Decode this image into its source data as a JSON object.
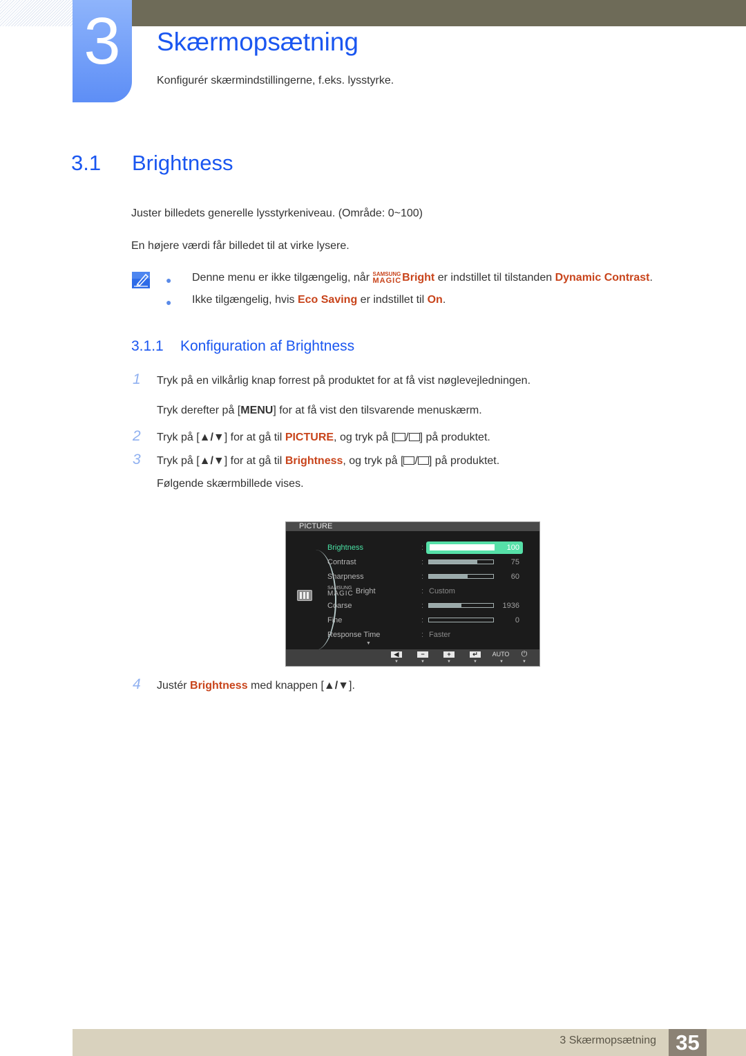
{
  "chapter": {
    "number": "3",
    "title": "Skærmopsætning",
    "subtitle": "Konfigurér skærmindstillingerne, f.eks. lysstyrke."
  },
  "section": {
    "number": "3.1",
    "title": "Brightness",
    "para1": "Juster billedets generelle lysstyrkeniveau. (Område: 0~100)",
    "para2": "En højere værdi får billedet til at virke lysere."
  },
  "notes": {
    "icon": "note-pencil-icon",
    "note1": {
      "before": "Denne menu er ikke tilgængelig, når ",
      "magic_top": "SAMSUNG",
      "magic_bottom": "MAGIC",
      "magic_word": "Bright",
      "middle": " er indstillet til tilstanden ",
      "highlight": "Dynamic Contrast",
      "after": "."
    },
    "note2": {
      "before": "Ikke tilgængelig, hvis ",
      "highlight1": "Eco Saving",
      "middle": " er indstillet til ",
      "highlight2": "On",
      "after": "."
    }
  },
  "subsection": {
    "number": "3.1.1",
    "title": "Konfiguration af Brightness"
  },
  "steps": {
    "s1": {
      "num": "1",
      "text": "Tryk på en vilkårlig knap forrest på produktet for at få vist nøglevejledningen."
    },
    "s1b": {
      "before": "Tryk derefter på [",
      "key": "MENU",
      "after": "] for at få vist den tilsvarende menuskærm."
    },
    "s2": {
      "num": "2",
      "before": "Tryk på [",
      "arrows": "▲/▼",
      "mid1": "] for at gå til ",
      "highlight": "PICTURE",
      "mid2": ", og tryk på [",
      "after": "] på produktet."
    },
    "s3": {
      "num": "3",
      "before": "Tryk på [",
      "arrows": "▲/▼",
      "mid1": "] for at gå til ",
      "highlight": "Brightness",
      "mid2": ", og tryk på [",
      "after": "] på produktet."
    },
    "s3b": "Følgende skærmbillede vises.",
    "s4": {
      "num": "4",
      "before": "Justér ",
      "highlight": "Brightness",
      "mid": " med knappen [",
      "arrows": "▲/▼",
      "after": "]."
    }
  },
  "osd": {
    "header": "PICTURE",
    "rows": [
      {
        "label": "Brightness",
        "value": 100,
        "max": 100,
        "display": "100",
        "active": true
      },
      {
        "label": "Contrast",
        "value": 75,
        "max": 100,
        "display": "75"
      },
      {
        "label": "Sharpness",
        "value": 60,
        "max": 100,
        "display": "60"
      },
      {
        "label_top": "SAMSUNG",
        "label_bottom": "MAGIC",
        "label_word": "Bright",
        "text_value": "Custom"
      },
      {
        "label": "Coarse",
        "value": 0.5,
        "max": 1,
        "display": "1936"
      },
      {
        "label": "Fine",
        "value": 0,
        "max": 100,
        "display": "0"
      },
      {
        "label": "Response Time",
        "text_value": "Faster"
      }
    ],
    "more_arrow": "▼",
    "buttons": [
      {
        "name": "left",
        "glyph": "◀"
      },
      {
        "name": "minus",
        "glyph": "−"
      },
      {
        "name": "plus",
        "glyph": "+"
      },
      {
        "name": "enter",
        "glyph": "↵"
      },
      {
        "name": "auto",
        "glyph": "AUTO"
      },
      {
        "name": "power",
        "glyph": "⏻"
      }
    ],
    "button_arrow": "▼"
  },
  "footer": {
    "text": "3 Skærmopsætning",
    "page": "35"
  },
  "colors": {
    "heading_blue": "#1a56f0",
    "highlight_orange": "#c8441b",
    "osd_active_green": "#56e0a8"
  }
}
